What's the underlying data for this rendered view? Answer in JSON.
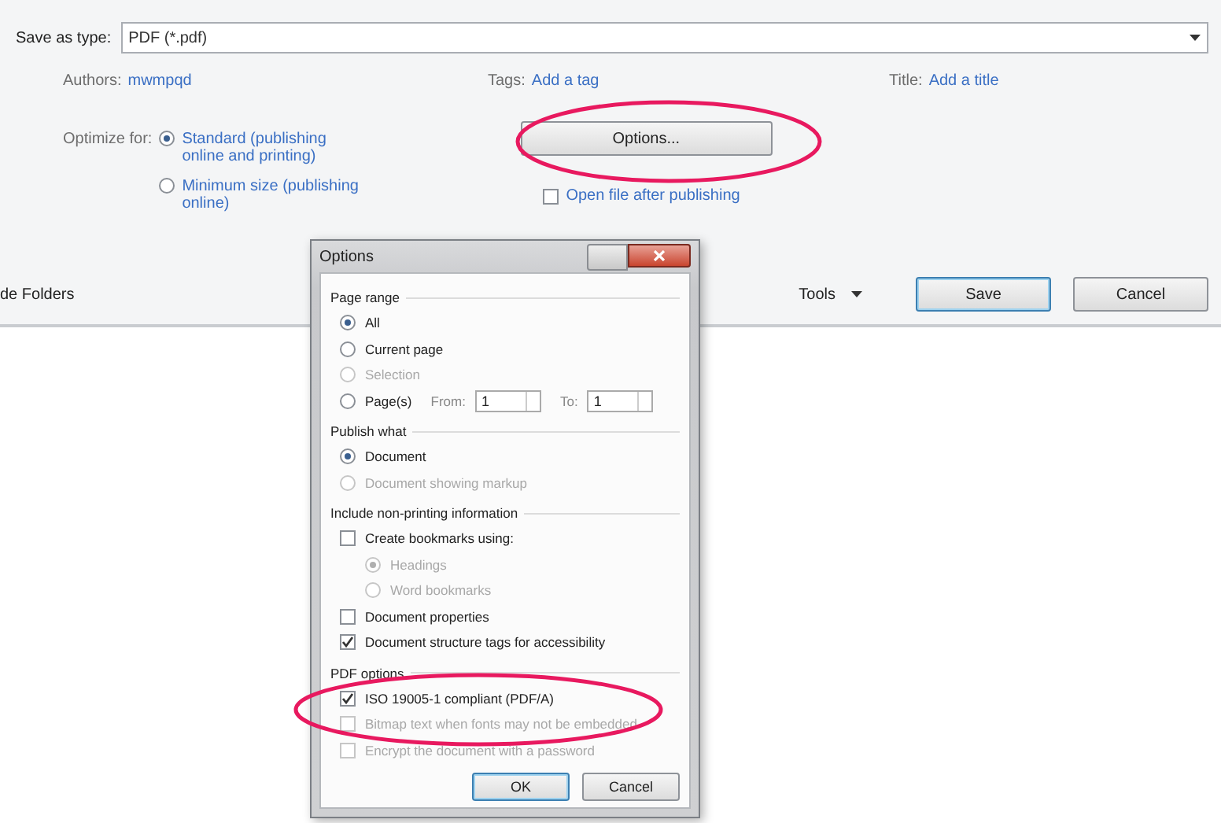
{
  "save_dialog": {
    "save_as_type": {
      "label": "Save as type:",
      "value": "PDF (*.pdf)"
    },
    "metadata": [
      {
        "label": "Authors:",
        "value": "mwmpqd"
      },
      {
        "label": "Tags:",
        "value": "Add a tag"
      },
      {
        "label": "Title:",
        "value": "Add a title"
      }
    ],
    "optimize": {
      "label": "Optimize for:",
      "choices": [
        {
          "label": "Standard (publishing online and printing)",
          "selected": true
        },
        {
          "label": "Minimum size (publishing online)",
          "selected": false
        }
      ]
    },
    "options_button": "Options...",
    "open_after": {
      "label": "Open file after publishing",
      "checked": false
    },
    "hide_folders": "de Folders",
    "tools": "Tools",
    "buttons": [
      {
        "label": "Save",
        "default": true
      },
      {
        "label": "Cancel",
        "default": false
      }
    ]
  },
  "options_dialog": {
    "title": "Options",
    "sections": [
      {
        "heading": "Page range",
        "items": [
          {
            "kind": "radio",
            "label": "All",
            "selected": true,
            "disabled": false
          },
          {
            "kind": "radio",
            "label": "Current page",
            "selected": false,
            "disabled": false
          },
          {
            "kind": "radio",
            "label": "Selection",
            "selected": false,
            "disabled": true
          },
          {
            "kind": "range",
            "label": "Page(s)",
            "selected": false,
            "disabled": false,
            "from_label": "From:",
            "from": "1",
            "to_label": "To:",
            "to": "1"
          }
        ]
      },
      {
        "heading": "Publish what",
        "items": [
          {
            "kind": "radio",
            "label": "Document",
            "selected": true,
            "disabled": false
          },
          {
            "kind": "radio",
            "label": "Document showing markup",
            "selected": false,
            "disabled": true
          }
        ]
      },
      {
        "heading": "Include non-printing information",
        "items": [
          {
            "kind": "checkbox",
            "label": "Create bookmarks using:",
            "checked": false,
            "disabled": false,
            "children": [
              {
                "kind": "radio",
                "label": "Headings",
                "selected": true,
                "disabled": true
              },
              {
                "kind": "radio",
                "label": "Word bookmarks",
                "selected": false,
                "disabled": true
              }
            ]
          },
          {
            "kind": "checkbox",
            "label": "Document properties",
            "checked": false,
            "disabled": false
          },
          {
            "kind": "checkbox",
            "label": "Document structure tags for accessibility",
            "checked": true,
            "disabled": false
          }
        ]
      },
      {
        "heading": "PDF options",
        "items": [
          {
            "kind": "checkbox",
            "label": "ISO 19005-1 compliant (PDF/A)",
            "checked": true,
            "disabled": false
          },
          {
            "kind": "checkbox",
            "label": "Bitmap text when fonts may not be embedded",
            "checked": false,
            "disabled": true
          },
          {
            "kind": "checkbox",
            "label": "Encrypt the document with a password",
            "checked": false,
            "disabled": true
          }
        ]
      }
    ],
    "buttons": [
      {
        "label": "OK",
        "default": true
      },
      {
        "label": "Cancel",
        "default": false
      }
    ]
  }
}
